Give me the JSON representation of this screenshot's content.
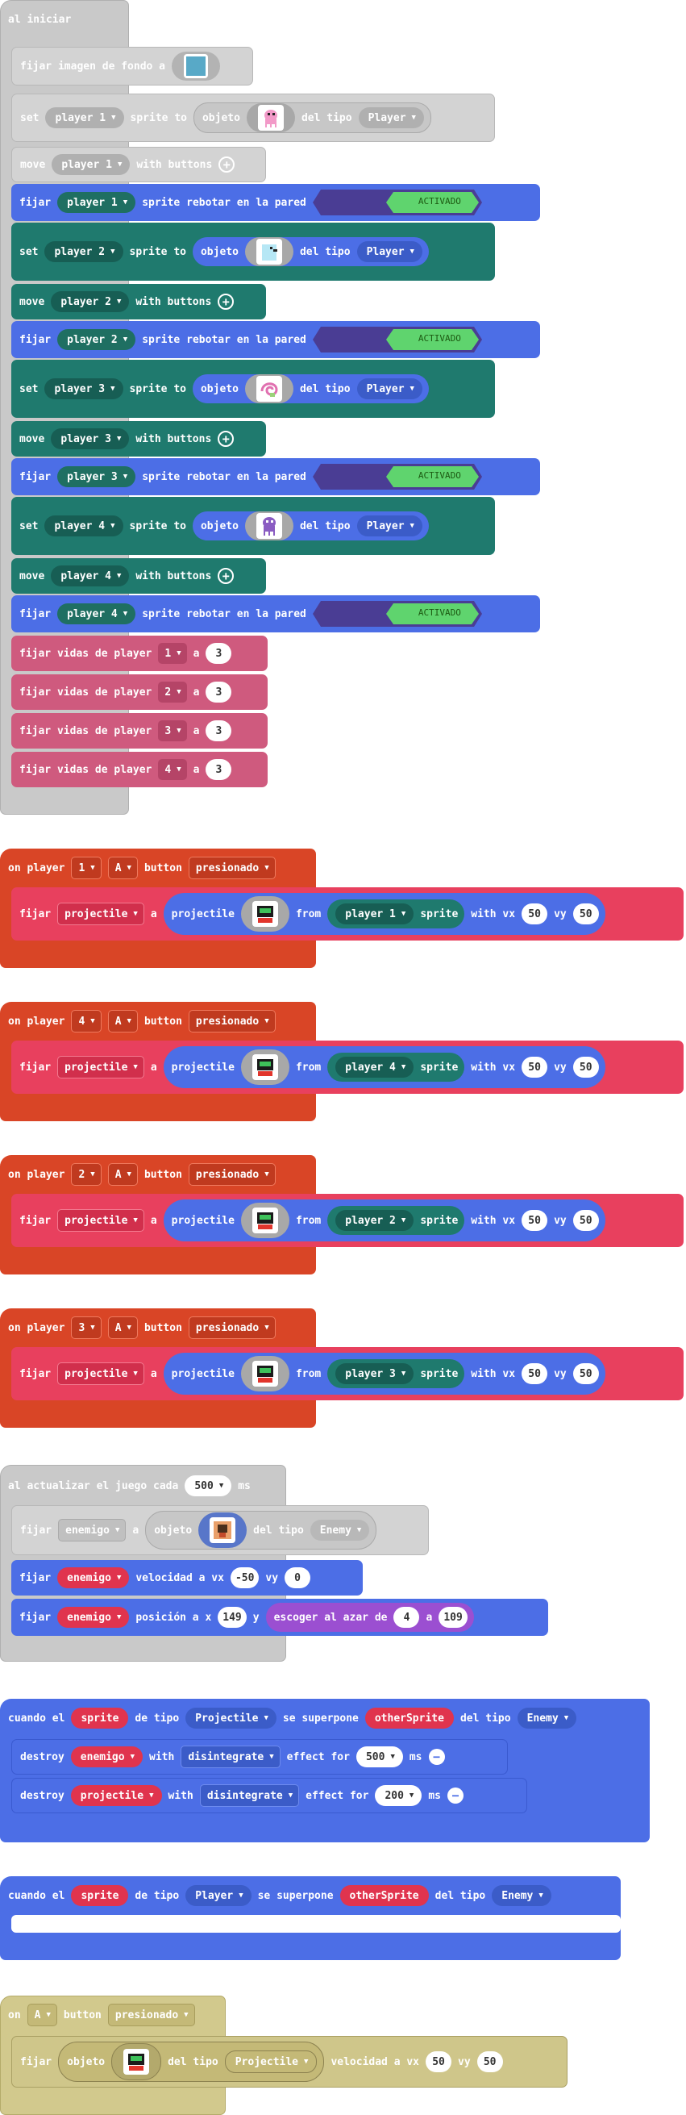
{
  "colors": {
    "scene": "#c7c7c7",
    "sprites": "#4a6cd4",
    "sprites_dark": "#1f7a6e",
    "info": "#cf5a7e",
    "controller": "#d94526",
    "projectile_set": "#e8405e",
    "game": "#bdb076",
    "random": "#9b4fd1"
  },
  "on_start": {
    "hat": "al iniciar",
    "bg": {
      "label": "fijar imagen de fondo a",
      "icon": "background-image-icon"
    },
    "set_p1": {
      "set": "set",
      "player": "player 1",
      "sprite_to": "sprite to",
      "objeto": "objeto",
      "del_tipo": "del tipo",
      "kind": "Player"
    },
    "move_p1": {
      "move": "move",
      "player": "player 1",
      "with": "with buttons"
    },
    "bounce_p1": {
      "fijar": "fijar",
      "player": "player 1",
      "sprite": "sprite",
      "rebotar": "rebotar en la pared",
      "state": "ACTIVADO"
    },
    "set_p2": {
      "set": "set",
      "player": "player 2",
      "sprite_to": "sprite to",
      "objeto": "objeto",
      "del_tipo": "del tipo",
      "kind": "Player"
    },
    "move_p2": {
      "move": "move",
      "player": "player 2",
      "with": "with buttons"
    },
    "bounce_p2": {
      "fijar": "fijar",
      "player": "player 2",
      "sprite": "sprite",
      "rebotar": "rebotar en la pared",
      "state": "ACTIVADO"
    },
    "set_p3": {
      "set": "set",
      "player": "player 3",
      "sprite_to": "sprite to",
      "objeto": "objeto",
      "del_tipo": "del tipo",
      "kind": "Player"
    },
    "move_p3": {
      "move": "move",
      "player": "player 3",
      "with": "with buttons"
    },
    "bounce_p3": {
      "fijar": "fijar",
      "player": "player 3",
      "sprite": "sprite",
      "rebotar": "rebotar en la pared",
      "state": "ACTIVADO"
    },
    "set_p4": {
      "set": "set",
      "player": "player 4",
      "sprite_to": "sprite to",
      "objeto": "objeto",
      "del_tipo": "del tipo",
      "kind": "Player"
    },
    "move_p4": {
      "move": "move",
      "player": "player 4",
      "with": "with buttons"
    },
    "bounce_p4": {
      "fijar": "fijar",
      "player": "player 4",
      "sprite": "sprite",
      "rebotar": "rebotar en la pared",
      "state": "ACTIVADO"
    },
    "lives": [
      {
        "label": "fijar vidas de player",
        "player": "1",
        "a": "a",
        "value": "3"
      },
      {
        "label": "fijar vidas de player",
        "player": "2",
        "a": "a",
        "value": "3"
      },
      {
        "label": "fijar vidas de player",
        "player": "3",
        "a": "a",
        "value": "3"
      },
      {
        "label": "fijar vidas de player",
        "player": "4",
        "a": "a",
        "value": "3"
      }
    ]
  },
  "controllers": [
    {
      "on": "on player",
      "player": "1",
      "btn": "A",
      "button": "button",
      "state": "presionado",
      "fijar": "fijar",
      "var": "projectile",
      "a": "a",
      "projectile": "projectile",
      "from": "from",
      "src": "player 1",
      "sprite": "sprite",
      "with_vx": "with vx",
      "vx": "50",
      "vy_label": "vy",
      "vy": "50"
    },
    {
      "on": "on player",
      "player": "4",
      "btn": "A",
      "button": "button",
      "state": "presionado",
      "fijar": "fijar",
      "var": "projectile",
      "a": "a",
      "projectile": "projectile",
      "from": "from",
      "src": "player 4",
      "sprite": "sprite",
      "with_vx": "with vx",
      "vx": "50",
      "vy_label": "vy",
      "vy": "50"
    },
    {
      "on": "on player",
      "player": "2",
      "btn": "A",
      "button": "button",
      "state": "presionado",
      "fijar": "fijar",
      "var": "projectile",
      "a": "a",
      "projectile": "projectile",
      "from": "from",
      "src": "player 2",
      "sprite": "sprite",
      "with_vx": "with vx",
      "vx": "50",
      "vy_label": "vy",
      "vy": "50"
    },
    {
      "on": "on player",
      "player": "3",
      "btn": "A",
      "button": "button",
      "state": "presionado",
      "fijar": "fijar",
      "var": "projectile",
      "a": "a",
      "projectile": "projectile",
      "from": "from",
      "src": "player 3",
      "sprite": "sprite",
      "with_vx": "with vx",
      "vx": "50",
      "vy_label": "vy",
      "vy": "50"
    }
  ],
  "update": {
    "hat": "al actualizar el juego cada",
    "interval": "500",
    "ms": "ms",
    "set_enemy": {
      "fijar": "fijar",
      "var": "enemigo",
      "a": "a",
      "objeto": "objeto",
      "del_tipo": "del tipo",
      "kind": "Enemy"
    },
    "velocity": {
      "fijar": "fijar",
      "var": "enemigo",
      "label": "velocidad a vx",
      "vx": "-50",
      "vy_label": "vy",
      "vy": "0"
    },
    "position": {
      "fijar": "fijar",
      "var": "enemigo",
      "label": "posición a x",
      "x": "149",
      "y_label": "y",
      "random": "escoger al azar de",
      "from": "4",
      "a": "a",
      "to": "109"
    }
  },
  "overlap1": {
    "cuando": "cuando el",
    "sprite": "sprite",
    "de_tipo": "de tipo",
    "kind": "Projectile",
    "superpone": "se superpone",
    "other": "otherSprite",
    "del_tipo": "del tipo",
    "other_kind": "Enemy",
    "d1": {
      "destroy": "destroy",
      "var": "enemigo",
      "with": "with",
      "effect": "disintegrate",
      "effect_for": "effect for",
      "ms_val": "500",
      "ms": "ms"
    },
    "d2": {
      "destroy": "destroy",
      "var": "projectile",
      "with": "with",
      "effect": "disintegrate",
      "effect_for": "effect for",
      "ms_val": "200",
      "ms": "ms"
    }
  },
  "overlap2": {
    "cuando": "cuando el",
    "sprite": "sprite",
    "de_tipo": "de tipo",
    "kind": "Player",
    "superpone": "se superpone",
    "other": "otherSprite",
    "del_tipo": "del tipo",
    "other_kind": "Enemy"
  },
  "button_event": {
    "on": "on",
    "btn": "A",
    "button": "button",
    "state": "presionado",
    "fijar": "fijar",
    "objeto": "objeto",
    "del_tipo": "del tipo",
    "kind": "Projectile",
    "velocidad": "velocidad a vx",
    "vx": "50",
    "vy_label": "vy",
    "vy": "50"
  }
}
